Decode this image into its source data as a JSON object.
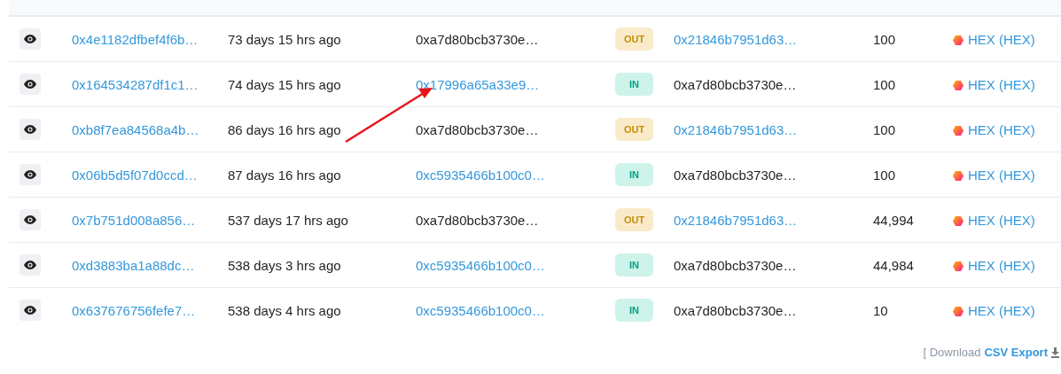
{
  "rows": [
    {
      "hash": "0x4e1182dfbef4f6b…",
      "age": "73 days 15 hrs ago",
      "from": "0xa7d80bcb3730e…",
      "from_link": false,
      "direction": "OUT",
      "kind": "out",
      "to": "0x21846b7951d63…",
      "to_link": true,
      "value": "100",
      "token": "HEX (HEX)"
    },
    {
      "hash": "0x164534287df1c1…",
      "age": "74 days 15 hrs ago",
      "from": "0x17996a65a33e9…",
      "from_link": true,
      "direction": "IN",
      "kind": "in",
      "to": "0xa7d80bcb3730e…",
      "to_link": false,
      "value": "100",
      "token": "HEX (HEX)"
    },
    {
      "hash": "0xb8f7ea84568a4b…",
      "age": "86 days 16 hrs ago",
      "from": "0xa7d80bcb3730e…",
      "from_link": false,
      "direction": "OUT",
      "kind": "out",
      "to": "0x21846b7951d63…",
      "to_link": true,
      "value": "100",
      "token": "HEX (HEX)"
    },
    {
      "hash": "0x06b5d5f07d0ccd…",
      "age": "87 days 16 hrs ago",
      "from": "0xc5935466b100c0…",
      "from_link": true,
      "direction": "IN",
      "kind": "in",
      "to": "0xa7d80bcb3730e…",
      "to_link": false,
      "value": "100",
      "token": "HEX (HEX)"
    },
    {
      "hash": "0x7b751d008a856…",
      "age": "537 days 17 hrs ago",
      "from": "0xa7d80bcb3730e…",
      "from_link": false,
      "direction": "OUT",
      "kind": "out",
      "to": "0x21846b7951d63…",
      "to_link": true,
      "value": "44,994",
      "token": "HEX (HEX)"
    },
    {
      "hash": "0xd3883ba1a88dc…",
      "age": "538 days 3 hrs ago",
      "from": "0xc5935466b100c0…",
      "from_link": true,
      "direction": "IN",
      "kind": "in",
      "to": "0xa7d80bcb3730e…",
      "to_link": false,
      "value": "44,984",
      "token": "HEX (HEX)"
    },
    {
      "hash": "0x637676756fefe7…",
      "age": "538 days 4 hrs ago",
      "from": "0xc5935466b100c0…",
      "from_link": true,
      "direction": "IN",
      "kind": "in",
      "to": "0xa7d80bcb3730e…",
      "to_link": false,
      "value": "10",
      "token": "HEX (HEX)"
    }
  ],
  "footer": {
    "prefix": "[ Download",
    "link": "CSV Export"
  }
}
